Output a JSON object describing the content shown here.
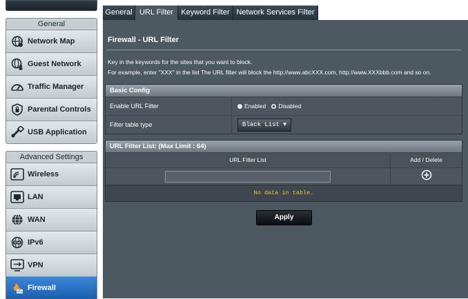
{
  "sidebar": {
    "general_label": "General",
    "general_items": [
      {
        "label": "Network Map",
        "icon": "globe-network-icon"
      },
      {
        "label": "Guest Network",
        "icon": "guest-globe-icon"
      },
      {
        "label": "Traffic Manager",
        "icon": "speedometer-icon"
      },
      {
        "label": "Parental Controls",
        "icon": "parental-lock-icon"
      },
      {
        "label": "USB Application",
        "icon": "usb-icon"
      }
    ],
    "advanced_label": "Advanced Settings",
    "advanced_items": [
      {
        "label": "Wireless",
        "icon": "wifi-icon"
      },
      {
        "label": "LAN",
        "icon": "lan-icon"
      },
      {
        "label": "WAN",
        "icon": "wan-globe-icon"
      },
      {
        "label": "IPv6",
        "icon": "ipv6-globe-icon"
      },
      {
        "label": "VPN",
        "icon": "vpn-icon"
      },
      {
        "label": "Firewall",
        "icon": "firewall-icon",
        "active": true
      }
    ]
  },
  "tabs": [
    {
      "label": "General"
    },
    {
      "label": "URL Filter",
      "active": true
    },
    {
      "label": "Keyword Filter"
    },
    {
      "label": "Network Services Filter"
    }
  ],
  "page": {
    "title": "Firewall - URL Filter",
    "desc_line1": "Key in the keywords for the sites that you want to block.",
    "desc_line2": "For example, enter \"XXX\" in the list The URL filter will block the http://www.abcXXX.com, http://www.XXXbbb.com and so on."
  },
  "basic_config": {
    "header": "Basic Config",
    "enable_label": "Enable URL Filter",
    "enabled_option": "Enabled",
    "disabled_option": "Disabled",
    "selected": "Disabled",
    "filter_type_label": "Filter table type",
    "filter_type_value": "Black List ▾"
  },
  "url_list": {
    "header": "URL Filter List: (Max Limit : 64)",
    "col_list": "URL Filter List",
    "col_action": "Add / Delete",
    "input_value": "",
    "empty_text": "No data in table."
  },
  "apply_label": "Apply",
  "colors": {
    "panel_bg": "#4d5961",
    "active_tab": "#4d5961",
    "active_sidebar": "#2a72c7",
    "nodata_text": "#f1c232"
  }
}
